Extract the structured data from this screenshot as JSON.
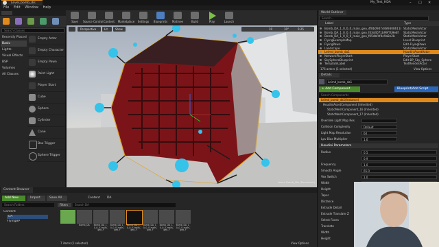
{
  "window": {
    "tab_title": "Level_bomb_dis",
    "project_title": "My_Test_HDA",
    "controls": [
      "–",
      "□",
      "✕"
    ]
  },
  "menu": [
    "File",
    "Edit",
    "Window",
    "Help"
  ],
  "modes": {
    "search_placeholder": "Search Classes",
    "categories": [
      "Recently Placed",
      "Basic",
      "Lights",
      "Visual Effects",
      "BSP",
      "Volumes",
      "All Classes"
    ],
    "selected_category": "Basic",
    "items": [
      "Empty Actor",
      "Empty Character",
      "Empty Pawn",
      "Point Light",
      "Player Start",
      "Cube",
      "Sphere",
      "Cylinder",
      "Cone",
      "Box Trigger",
      "Sphere Trigger"
    ]
  },
  "toolbar": {
    "buttons": [
      "Save",
      "Source Control",
      "Content",
      "Marketplace",
      "Settings",
      "Blueprints",
      "Matinee",
      "Build",
      "Play",
      "Launch"
    ]
  },
  "viewport": {
    "view_mode": "Perspective",
    "lit_mode": "Lit",
    "show": "Show",
    "grid_value": "10",
    "angle_value": "10°",
    "scale_value": "0.25",
    "status": "Level: Bomb_Dis (Persistent)"
  },
  "outliner": {
    "title": "World Outliner",
    "search_placeholder": "Search...",
    "col_label": "Label",
    "col_type": "Type",
    "rows": [
      {
        "label": "Bomb_DA_1_0_0_0_main_geo_4f8b0947d4893086118",
        "type": "StaticMeshActor"
      },
      {
        "label": "Bomb_DA_1_0_0_0_main_geo_f43d4071b99f7b9e8f",
        "type": "StaticMeshActor"
      },
      {
        "label": "Bomb_DA_1_0_0_0_main_geo_f05dbf4f4e9a8e2b",
        "type": "StaticMeshActor"
      },
      {
        "label": "FlyingExampleMap",
        "type": "Level Blueprint"
      },
      {
        "label": "FlyingPawn",
        "type": "Edit-FlyingPawn"
      },
      {
        "label": "Landscape",
        "type": "StaticMeshActor"
      },
      {
        "label": "Leimd_bomb_da1",
        "type": "HoudiniAssetActor"
      },
      {
        "label": "NetworkPlayerStart",
        "type": "PlayerStart"
      },
      {
        "label": "SkySphereBlueprint",
        "type": "Edit-BP_Sky_Sphere"
      },
      {
        "label": "TemplateLabel",
        "type": "TextRenderActor"
      }
    ],
    "selected_row": 6,
    "footer": "176 actors (1 selected)",
    "view_options": "View Options"
  },
  "details": {
    "title": "Details",
    "name_value": "Leimd_bomb_da1",
    "add_component": "+ Add Component",
    "blueprint_btn": "Blueprint/Add Script",
    "search_placeholder": "Search Components",
    "components": [
      "Leimd_bomb_da1(Instance)",
      "HoudiniAssetComponent (Inherited)",
      "StaticMeshComponent_16 (Inherited)",
      "StaticMeshComponent_17 (Inherited)"
    ],
    "properties": [
      {
        "label": "Override Light Map Res",
        "value": ""
      },
      {
        "label": "Collision Complexity",
        "value": "Default"
      },
      {
        "label": "Light Map Resolution",
        "value": "64"
      },
      {
        "label": "Lpv Bias Multiplier",
        "value": "1.0"
      }
    ],
    "houdini_section": "Houdini Parameters",
    "params": [
      {
        "label": "Radius",
        "value": "0.5"
      },
      {
        "label": "",
        "value": "0.9"
      },
      {
        "label": "Frequency",
        "value": "1.0"
      },
      {
        "label": "Smooth Angle",
        "value": "65.0"
      },
      {
        "label": "Vex Switch",
        "value": "1.0"
      },
      {
        "label": "Width",
        "value": ""
      },
      {
        "label": "Height",
        "value": ""
      },
      {
        "label": "Taper",
        "value": ""
      },
      {
        "label": "Distance",
        "value": ""
      },
      {
        "label": "Extrude Detail",
        "value": ""
      },
      {
        "label": "Extrude Translate Z",
        "value": ""
      },
      {
        "label": "Select Faces",
        "value": ""
      },
      {
        "label": "Translate",
        "value": ""
      },
      {
        "label": "Width",
        "value": ""
      },
      {
        "label": "Height",
        "value": ""
      }
    ]
  },
  "content_browser": {
    "tab": "Content Browser",
    "add_new": "Add New",
    "import": "Import",
    "save_all": "Save All",
    "path": [
      "Content",
      "DA"
    ],
    "search_folders": "Search Folders",
    "filters": "Filters",
    "search_da": "Search DA",
    "tree": [
      "Content",
      "DA",
      "FlyingBP"
    ],
    "assets": [
      "",
      "Bomb_DA",
      "Bomb_DA_1_0_0_0_main_geo_F",
      "Bomb_DA_1_0_0_0_main_geo_F",
      "Bomb_DA_1_0_0_0_main_geo_F",
      "Bomb_DA_1_0_0_0_main_geo_F",
      "Bomb_DA_1_0_0_0_main_geo_F",
      "Bomb_DA_1_0_0_0_main_geo_F"
    ],
    "footer": "7 items (1 selected)",
    "view_options": "View Options"
  },
  "colors": {
    "accent_orange": "#e08a1e",
    "selection_blue": "#2b4e7d",
    "handle_cyan": "#35c3ea",
    "add_green": "#4a8a2a",
    "bp_blue": "#2a66b8"
  }
}
